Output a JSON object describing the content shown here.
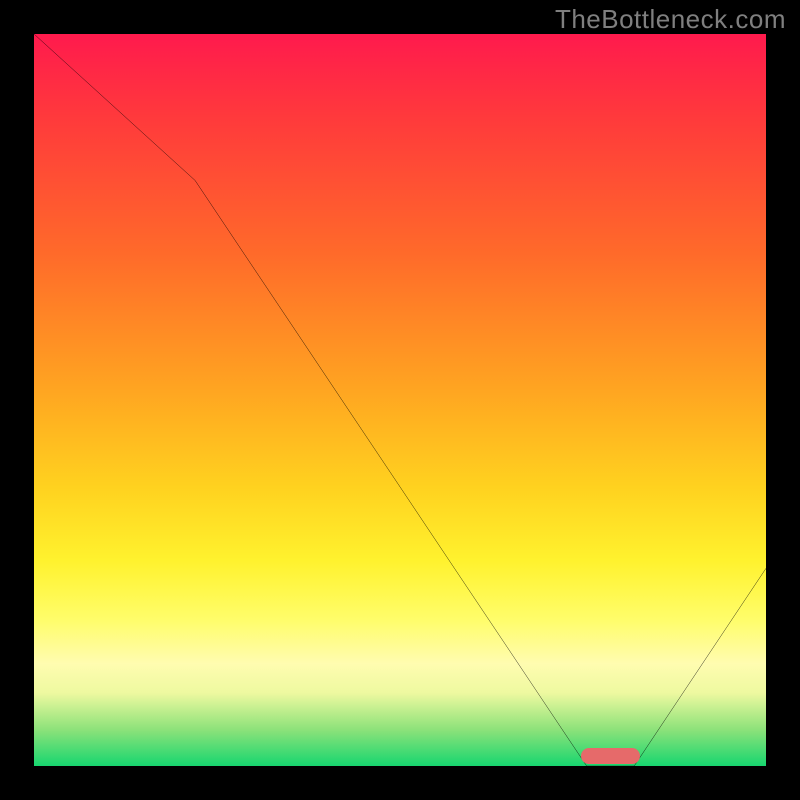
{
  "watermark": "TheBottleneck.com",
  "colors": {
    "frame": "#000000",
    "watermark": "#7f7f7f",
    "curve": "#000000",
    "marker": "#e66a6a"
  },
  "chart_data": {
    "type": "line",
    "title": "",
    "xlabel": "",
    "ylabel": "",
    "xlim": [
      0,
      100
    ],
    "ylim": [
      0,
      100
    ],
    "background_gradient": {
      "top": "#ff1a4d",
      "bottom": "#17d66f",
      "note": "approximate bottleneck heat gradient: red at top, green at bottom"
    },
    "x": [
      0,
      22,
      75.5,
      82,
      100
    ],
    "y": [
      100,
      80,
      0,
      0,
      27
    ],
    "marker": {
      "x_start": 75.5,
      "x_end": 82,
      "y": 0.5
    }
  }
}
